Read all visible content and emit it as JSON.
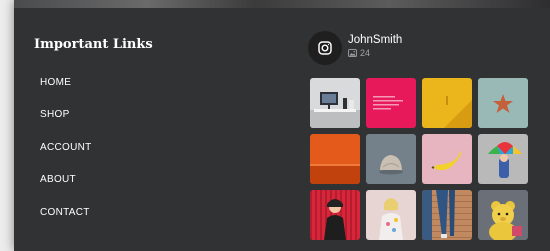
{
  "links": {
    "title": "Important Links",
    "items": [
      {
        "label": "HOME"
      },
      {
        "label": "SHOP"
      },
      {
        "label": "ACCOUNT"
      },
      {
        "label": "ABOUT"
      },
      {
        "label": "CONTACT"
      }
    ]
  },
  "instagram": {
    "icon": "instagram-icon",
    "username": "JohnSmith",
    "post_icon": "image-icon",
    "post_count": "24",
    "photos": [
      {
        "subject": "desk-setup",
        "color": "#d9dadb"
      },
      {
        "subject": "pink-card",
        "color": "#e8195a"
      },
      {
        "subject": "yellow-wall",
        "color": "#eab61c"
      },
      {
        "subject": "starfish",
        "color": "#8fb1b0"
      },
      {
        "subject": "orange-wall",
        "color": "#e35a1a"
      },
      {
        "subject": "sea-urchin",
        "color": "#75818a"
      },
      {
        "subject": "banana",
        "color": "#e6b5c0"
      },
      {
        "subject": "umbrella",
        "color": "#b9b9b9"
      },
      {
        "subject": "woman-red-wall",
        "color": "#d7263a"
      },
      {
        "subject": "woman-sweater",
        "color": "#e7d5d3"
      },
      {
        "subject": "jeans",
        "color": "#c1895f"
      },
      {
        "subject": "plush-toy",
        "color": "#6b6f78"
      }
    ]
  }
}
